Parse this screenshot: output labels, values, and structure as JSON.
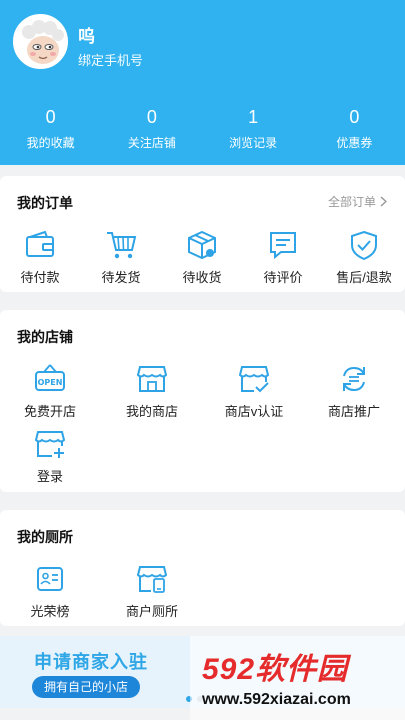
{
  "profile": {
    "username": "呜",
    "bind_phone": "绑定手机号"
  },
  "stats": [
    {
      "count": "0",
      "label": "我的收藏"
    },
    {
      "count": "0",
      "label": "关注店铺"
    },
    {
      "count": "1",
      "label": "浏览记录"
    },
    {
      "count": "0",
      "label": "优惠券"
    }
  ],
  "orders": {
    "title": "我的订单",
    "all_orders": "全部订单",
    "items": [
      {
        "label": "待付款",
        "icon": "wallet-icon"
      },
      {
        "label": "待发货",
        "icon": "cart-icon"
      },
      {
        "label": "待收货",
        "icon": "package-icon"
      },
      {
        "label": "待评价",
        "icon": "comment-icon"
      },
      {
        "label": "售后/退款",
        "icon": "shield-check-icon"
      }
    ]
  },
  "shop": {
    "title": "我的店铺",
    "items": [
      {
        "label": "免费开店",
        "icon": "open-sign-icon"
      },
      {
        "label": "我的商店",
        "icon": "store-icon"
      },
      {
        "label": "商店v认证",
        "icon": "store-verified-icon"
      },
      {
        "label": "商店推广",
        "icon": "refresh-arrows-icon"
      },
      {
        "label": "登录",
        "icon": "store-add-icon"
      }
    ]
  },
  "toilet": {
    "title": "我的厕所",
    "items": [
      {
        "label": "光荣榜",
        "icon": "id-card-icon"
      },
      {
        "label": "商户厕所",
        "icon": "store-phone-icon"
      }
    ]
  },
  "banner": {
    "title": "申请商家入驻",
    "subtitle": "拥有自己的小店"
  },
  "watermark": {
    "logo": "592软件园",
    "url": "www.592xiazai.com"
  },
  "colors": {
    "primary": "#2fb2ef",
    "icon": "#2ea3e6",
    "banner_bg": "#e6f3fc"
  }
}
